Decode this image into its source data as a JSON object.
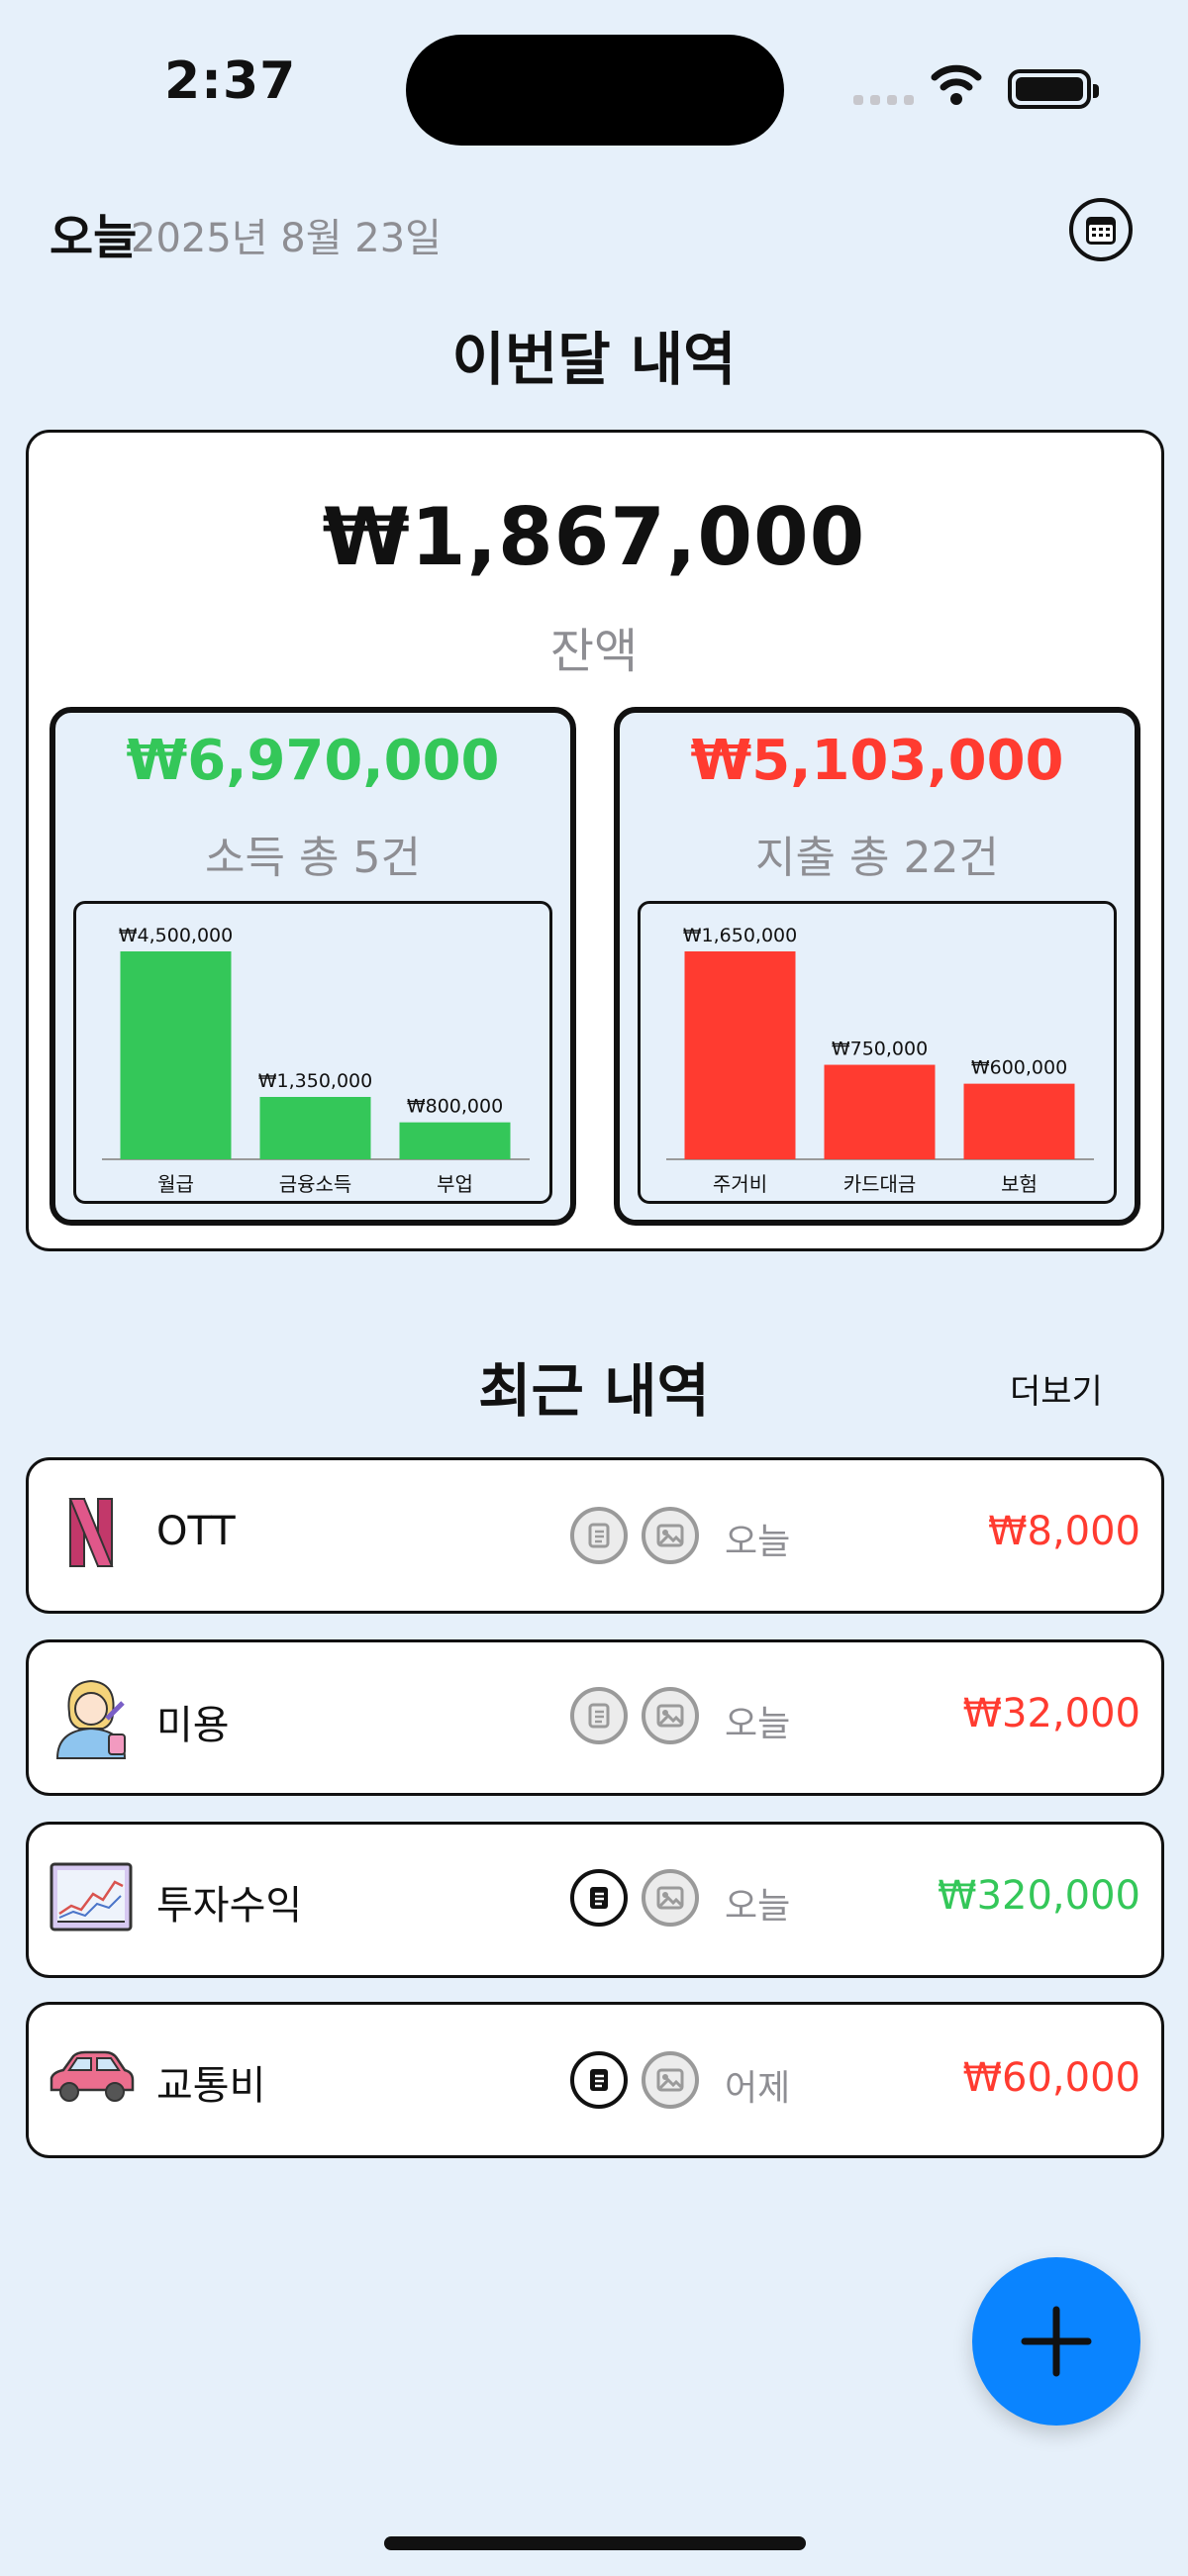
{
  "status": {
    "time": "2:37"
  },
  "header": {
    "today_label": "오늘",
    "date": "2025년 8월 23일"
  },
  "monthly": {
    "title": "이번달 내역",
    "balance": "₩1,867,000",
    "balance_label": "잔액",
    "income": {
      "amount": "₩6,970,000",
      "label": "소득 총 5건"
    },
    "expense": {
      "amount": "₩5,103,000",
      "label": "지출 총 22건"
    }
  },
  "chart_data": [
    {
      "type": "bar",
      "categories": [
        "월급",
        "금융소득",
        "부업"
      ],
      "values": [
        4500000,
        1350000,
        800000
      ],
      "labels": [
        "₩4,500,000",
        "₩1,350,000",
        "₩800,000"
      ],
      "color": "#34c759"
    },
    {
      "type": "bar",
      "categories": [
        "주거비",
        "카드대금",
        "보험"
      ],
      "values": [
        1650000,
        750000,
        600000
      ],
      "labels": [
        "₩1,650,000",
        "₩750,000",
        "₩600,000"
      ],
      "color": "#ff3b30"
    }
  ],
  "recent": {
    "title": "최근 내역",
    "more": "더보기",
    "items": [
      {
        "name": "OTT",
        "icon": "netflix-icon",
        "memo_active": false,
        "when": "오늘",
        "amount": "₩8,000",
        "kind": "expense"
      },
      {
        "name": "미용",
        "icon": "beauty-icon",
        "memo_active": false,
        "when": "오늘",
        "amount": "₩32,000",
        "kind": "expense"
      },
      {
        "name": "투자수익",
        "icon": "stock-chart-icon",
        "memo_active": true,
        "when": "오늘",
        "amount": "₩320,000",
        "kind": "income"
      },
      {
        "name": "교통비",
        "icon": "car-icon",
        "memo_active": true,
        "when": "어제",
        "amount": "₩60,000",
        "kind": "expense"
      }
    ]
  },
  "colors": {
    "income": "#34c759",
    "expense": "#ff3b30",
    "accent": "#0a84ff",
    "background": "#e6f0fa"
  }
}
